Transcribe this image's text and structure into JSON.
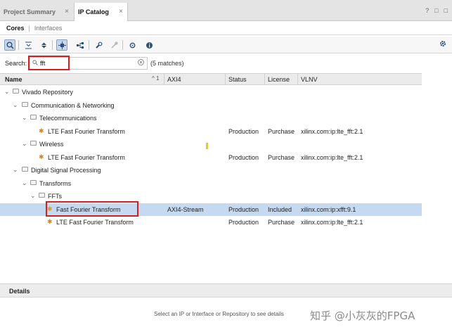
{
  "tabs": [
    {
      "label": "Project Summary",
      "close": "×"
    },
    {
      "label": "IP Catalog",
      "close": "×"
    }
  ],
  "window_icons": {
    "help": "?",
    "restore": "□",
    "maximize": "□"
  },
  "subtabs": {
    "selected": "Cores",
    "separator": "|",
    "other": "Interfaces"
  },
  "search": {
    "label": "Search:",
    "value": "fft",
    "matches": "(5 matches)"
  },
  "columns": {
    "name": "Name",
    "sort": "^ 1",
    "axi4": "AXI4",
    "status": "Status",
    "license": "License",
    "vlnv": "VLNV"
  },
  "tree": [
    {
      "type": "folder",
      "name": "Vivado Repository"
    },
    {
      "type": "folder",
      "name": "Communication & Networking"
    },
    {
      "type": "folder",
      "name": "Telecommunications"
    },
    {
      "type": "ip",
      "name": "LTE Fast Fourier Transform",
      "axi4": "",
      "status": "Production",
      "license": "Purchase",
      "vlnv": "xilinx.com:ip:lte_fft:2.1"
    },
    {
      "type": "folder",
      "name": "Wireless"
    },
    {
      "type": "ip",
      "name": "LTE Fast Fourier Transform",
      "axi4": "",
      "status": "Production",
      "license": "Purchase",
      "vlnv": "xilinx.com:ip:lte_fft:2.1"
    },
    {
      "type": "folder",
      "name": "Digital Signal Processing"
    },
    {
      "type": "folder",
      "name": "Transforms"
    },
    {
      "type": "folder",
      "name": "FFTs"
    },
    {
      "type": "ip",
      "name": "Fast Fourier Transform",
      "axi4": "AXI4-Stream",
      "status": "Production",
      "license": "Included",
      "vlnv": "xilinx.com:ip:xfft:9.1"
    },
    {
      "type": "ip",
      "name": "LTE Fast Fourier Transform",
      "axi4": "",
      "status": "Production",
      "license": "Purchase",
      "vlnv": "xilinx.com:ip:lte_fft:2.1"
    }
  ],
  "details": {
    "title": "Details",
    "message": "Select an IP or Interface or Repository to see details"
  },
  "watermark": "知乎 @小灰灰的FPGA",
  "colors": {
    "selection": "#c5d9f1",
    "highlight_box": "#d42020",
    "accent": "#2c4f7c"
  }
}
